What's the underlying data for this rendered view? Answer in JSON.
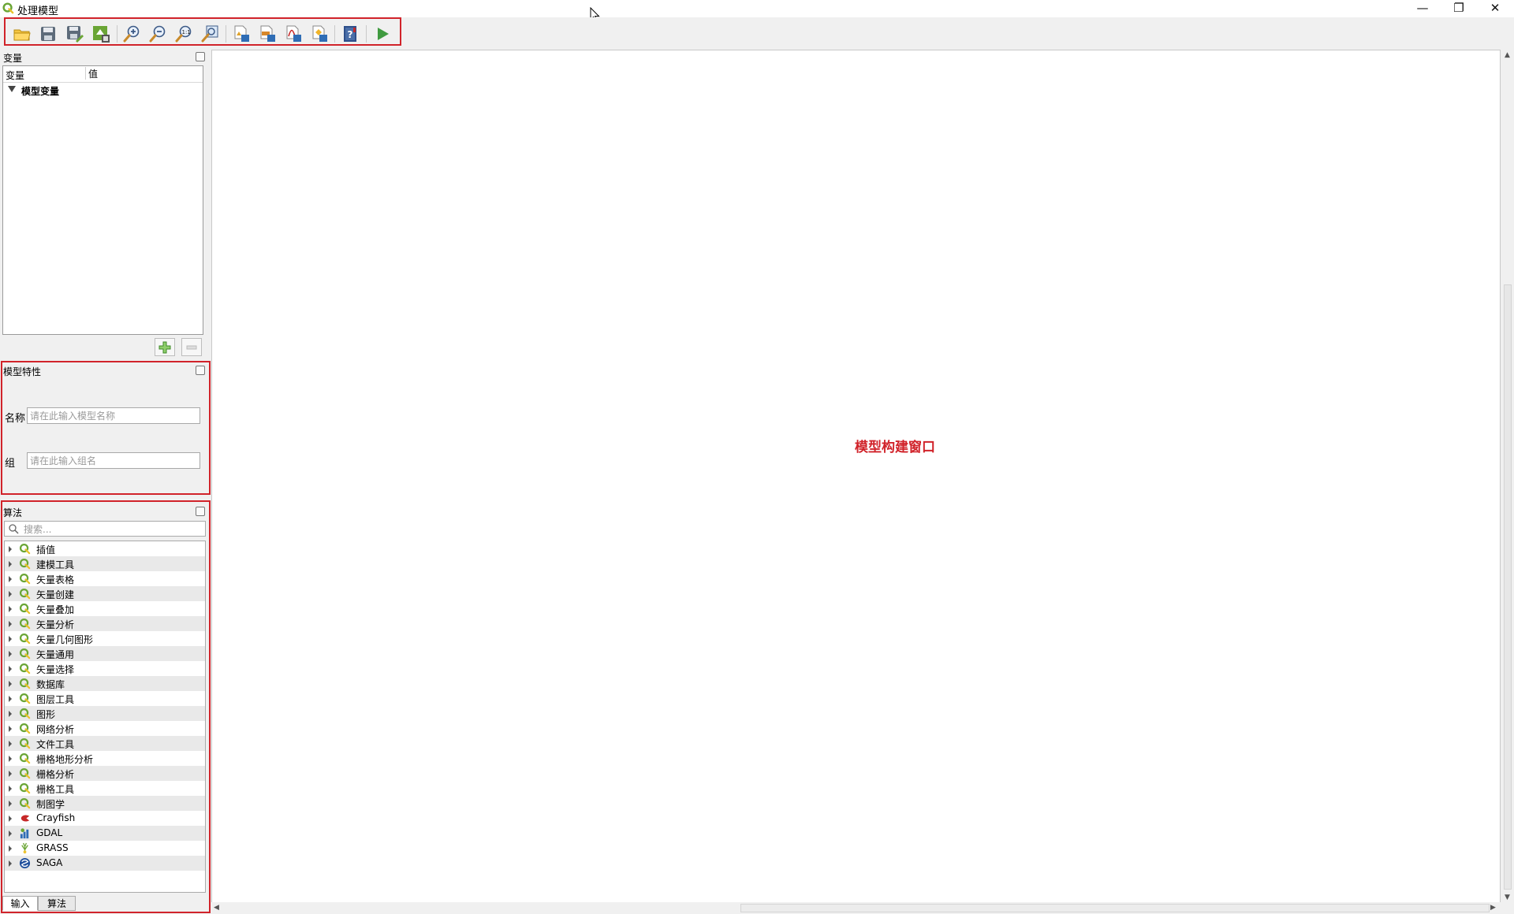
{
  "window": {
    "title": "处理模型",
    "controls": {
      "minimize": "—",
      "restore": "❐",
      "close": "✕"
    }
  },
  "toolbar": {
    "buttons": [
      {
        "name": "open-model",
        "icon": "folder-icon"
      },
      {
        "name": "save-model",
        "icon": "save-icon"
      },
      {
        "name": "save-as",
        "icon": "save-as-icon"
      },
      {
        "name": "save-to-project",
        "icon": "save-to-project-icon"
      },
      {
        "name": "zoom-in",
        "icon": "zoom-in-icon"
      },
      {
        "name": "zoom-out",
        "icon": "zoom-out-icon"
      },
      {
        "name": "zoom-actual",
        "icon": "zoom-actual-icon"
      },
      {
        "name": "zoom-full",
        "icon": "zoom-full-icon"
      },
      {
        "name": "export-image",
        "icon": "export-image-icon"
      },
      {
        "name": "export-svg",
        "icon": "export-svg-icon"
      },
      {
        "name": "export-pdf",
        "icon": "export-pdf-icon"
      },
      {
        "name": "export-python",
        "icon": "export-python-icon"
      },
      {
        "name": "edit-help",
        "icon": "help-icon"
      },
      {
        "name": "run-model",
        "icon": "run-icon"
      }
    ]
  },
  "variables": {
    "title": "变量",
    "columns": [
      "变量",
      "值"
    ],
    "group": "模型变量",
    "add_button": "+",
    "remove_button": "−"
  },
  "model_properties": {
    "title": "模型特性",
    "name_label": "名称",
    "name_placeholder": "请在此输入模型名称",
    "group_label": "组",
    "group_placeholder": "请在此输入组名"
  },
  "algorithms": {
    "title": "算法",
    "search_placeholder": "搜索...",
    "items": [
      {
        "label": "插值",
        "icon": "qgis-icon"
      },
      {
        "label": "建模工具",
        "icon": "qgis-icon"
      },
      {
        "label": "矢量表格",
        "icon": "qgis-icon"
      },
      {
        "label": "矢量创建",
        "icon": "qgis-icon"
      },
      {
        "label": "矢量叠加",
        "icon": "qgis-icon"
      },
      {
        "label": "矢量分析",
        "icon": "qgis-icon"
      },
      {
        "label": "矢量几何图形",
        "icon": "qgis-icon"
      },
      {
        "label": "矢量通用",
        "icon": "qgis-icon"
      },
      {
        "label": "矢量选择",
        "icon": "qgis-icon"
      },
      {
        "label": "数据库",
        "icon": "qgis-icon"
      },
      {
        "label": "图层工具",
        "icon": "qgis-icon"
      },
      {
        "label": "图形",
        "icon": "qgis-icon"
      },
      {
        "label": "网络分析",
        "icon": "qgis-icon"
      },
      {
        "label": "文件工具",
        "icon": "qgis-icon"
      },
      {
        "label": "栅格地形分析",
        "icon": "qgis-icon"
      },
      {
        "label": "栅格分析",
        "icon": "qgis-icon"
      },
      {
        "label": "栅格工具",
        "icon": "qgis-icon"
      },
      {
        "label": "制图学",
        "icon": "qgis-icon"
      },
      {
        "label": "Crayfish",
        "icon": "crayfish-icon"
      },
      {
        "label": "GDAL",
        "icon": "gdal-icon"
      },
      {
        "label": "GRASS",
        "icon": "grass-icon"
      },
      {
        "label": "SAGA",
        "icon": "saga-icon"
      }
    ]
  },
  "bottom_tabs": [
    "输入",
    "算法"
  ],
  "canvas": {
    "annotation": "模型构建窗口"
  },
  "colors": {
    "highlight": "#d1232a",
    "qgis_green": "#6aa535"
  }
}
